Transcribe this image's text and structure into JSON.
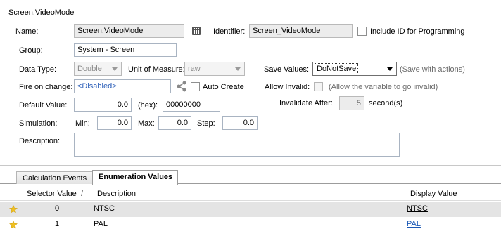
{
  "header": {
    "title": "Screen.VideoMode"
  },
  "form": {
    "name_label": "Name:",
    "name_value": "Screen.VideoMode",
    "identifier_label": "Identifier:",
    "identifier_value": "Screen_VideoMode",
    "include_id_label": "Include ID for Programming",
    "group_label": "Group:",
    "group_value": "System - Screen",
    "data_type_label": "Data Type:",
    "data_type_value": "Double",
    "unit_label": "Unit of Measure:",
    "unit_value": "raw",
    "save_values_label": "Save Values:",
    "save_values_value": "DoNotSave",
    "save_values_hint": "(Save with actions)",
    "fire_label": "Fire on change:",
    "fire_value": "<Disabled>",
    "auto_create_label": "Auto Create",
    "allow_invalid_label": "Allow Invalid:",
    "allow_invalid_hint": "(Allow the variable to go invalid)",
    "default_label": "Default Value:",
    "default_value": "0.0",
    "hex_label": "(hex):",
    "hex_value": "00000000",
    "invalidate_label": "Invalidate After:",
    "invalidate_value": "5",
    "invalidate_unit": "second(s)",
    "simulation_label": "Simulation:",
    "min_label": "Min:",
    "min_value": "0.0",
    "max_label": "Max:",
    "max_value": "0.0",
    "step_label": "Step:",
    "step_value": "0.0",
    "description_label": "Description:",
    "description_value": ""
  },
  "tabs": [
    {
      "label": "Calculation Events"
    },
    {
      "label": "Enumeration Values"
    }
  ],
  "grid": {
    "columns": [
      "Selector Value",
      "Description",
      "Display Value"
    ],
    "sort_indicator": "/",
    "rows": [
      {
        "selector": "0",
        "description": "NTSC",
        "display": "NTSC"
      },
      {
        "selector": "1",
        "description": "PAL",
        "display": "PAL"
      }
    ]
  },
  "colors": {
    "link_blue": "#1a58b6",
    "selected_row": "#e4e4e4",
    "star": "#f0c020"
  }
}
